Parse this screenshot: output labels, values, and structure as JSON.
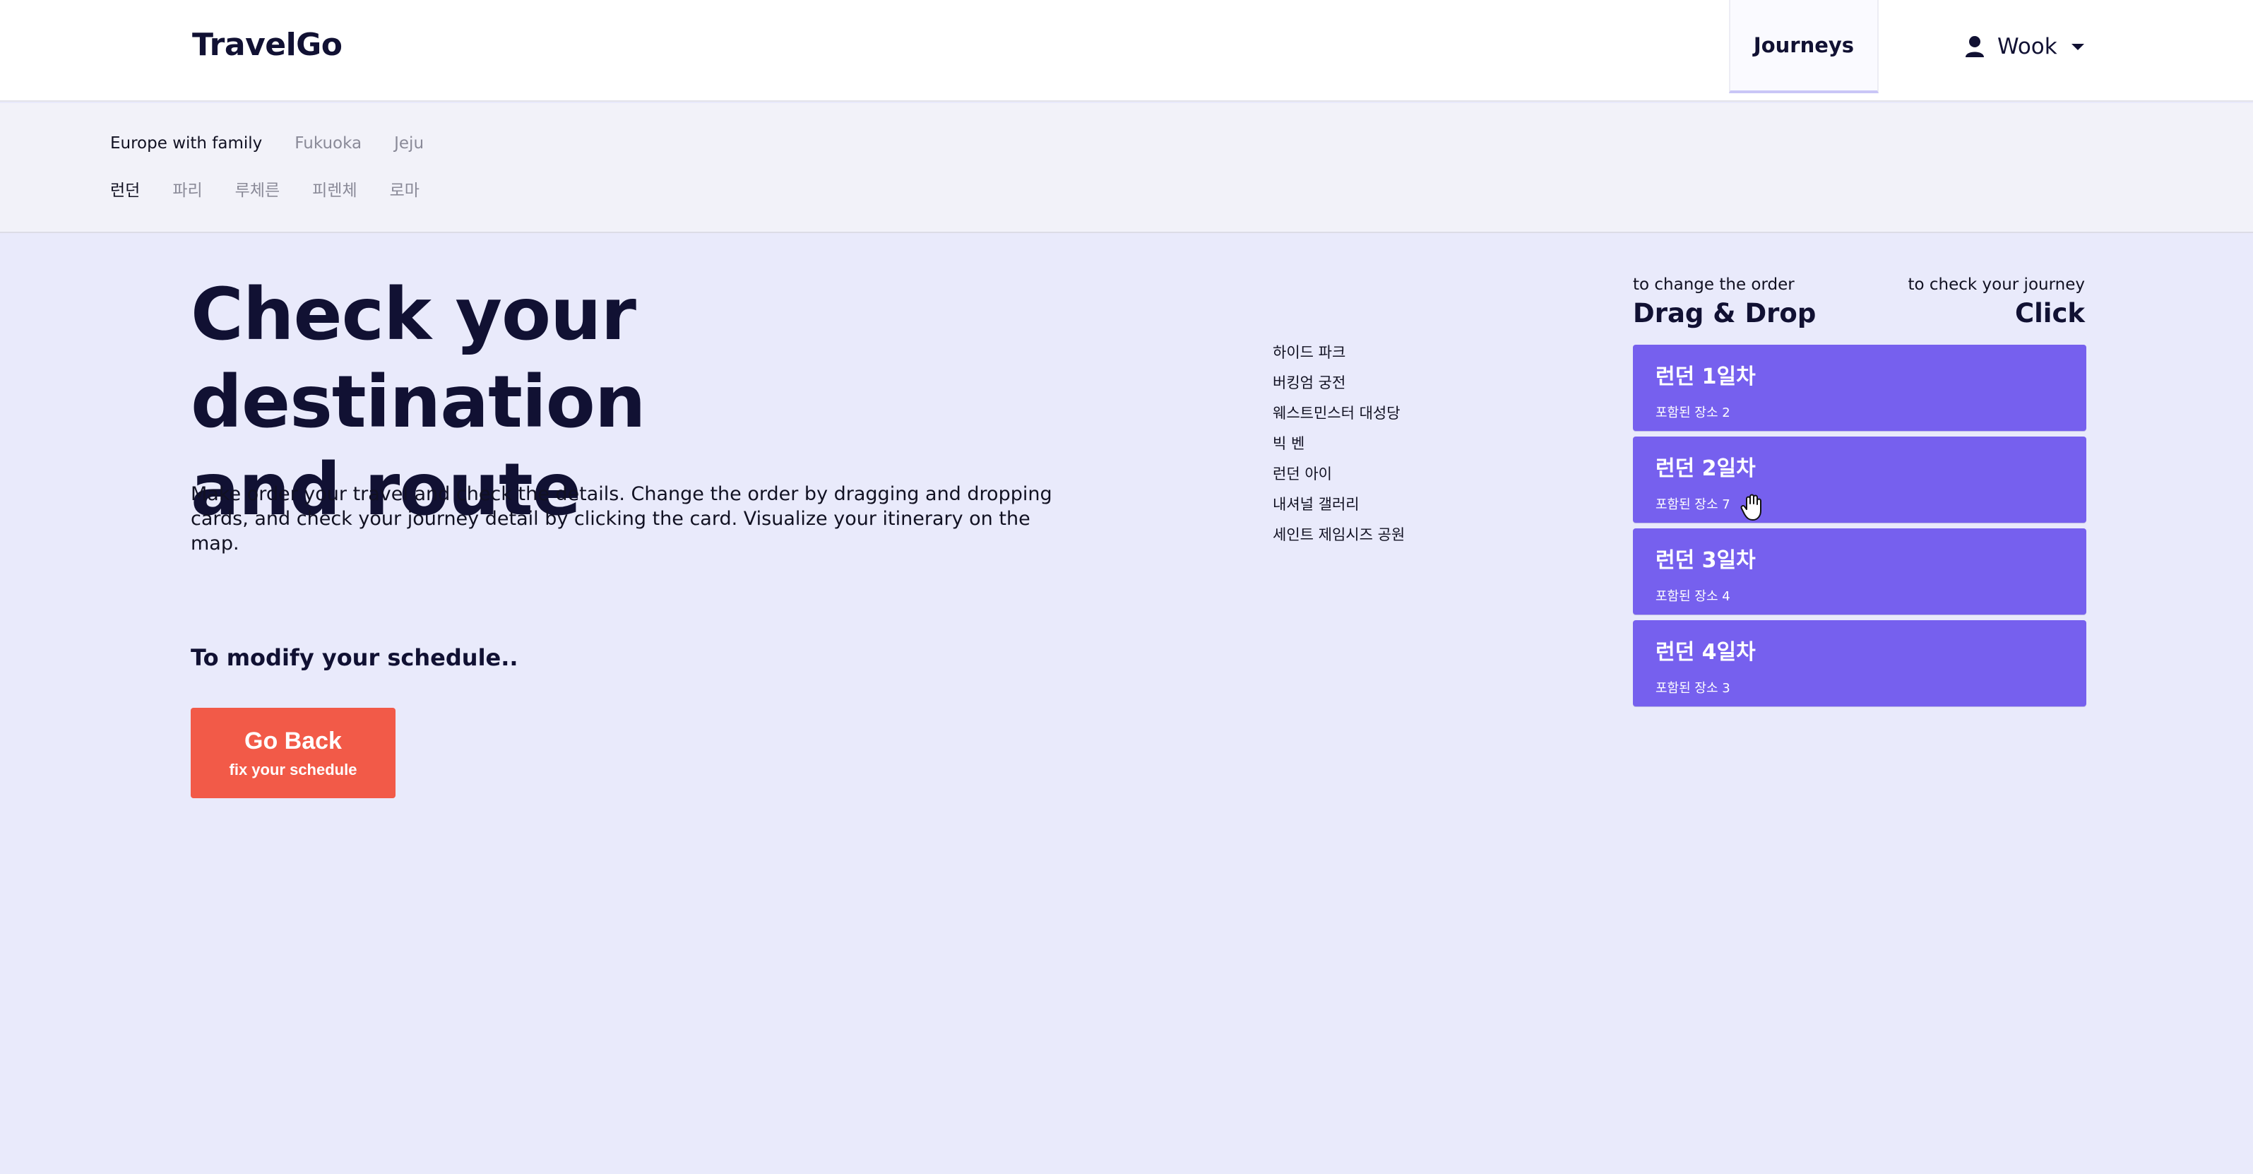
{
  "header": {
    "logo": "TravelGo",
    "nav_journeys": "Journeys",
    "user_name": "Wook",
    "user_icon": "user-icon",
    "dropdown_icon": "caret-down-icon"
  },
  "subnav": {
    "trips": [
      {
        "label": "Europe with family",
        "active": true
      },
      {
        "label": "Fukuoka",
        "active": false
      },
      {
        "label": "Jeju",
        "active": false
      }
    ],
    "cities": [
      {
        "label": "런던",
        "active": true
      },
      {
        "label": "파리",
        "active": false
      },
      {
        "label": "루체른",
        "active": false
      },
      {
        "label": "피렌체",
        "active": false
      },
      {
        "label": "로마",
        "active": false
      }
    ]
  },
  "main": {
    "title_line1": "Check your destination",
    "title_line2": "and route",
    "description": "Make order your travel and check the details. Change the order by dragging and dropping cards, and check your journey detail by clicking the card. Visualize your itinerary on the map.",
    "modify_label": "To modify your schedule..",
    "go_back": {
      "label": "Go Back",
      "sublabel": "fix your schedule"
    }
  },
  "places": [
    "하이드 파크",
    "버킹엄 궁전",
    "웨스트민스터 대성당",
    "빅 벤",
    "런던 아이",
    "내셔널 갤러리",
    "세인트 제임시즈 공원"
  ],
  "panel": {
    "hint_left_small": "to change the order",
    "hint_left_big": "Drag & Drop",
    "hint_right_small": "to check your journey",
    "hint_right_big": "Click",
    "days": [
      {
        "title": "런던 1일차",
        "count": "포함된 장소 2"
      },
      {
        "title": "런던 2일차",
        "count": "포함된 장소 7"
      },
      {
        "title": "런던 3일차",
        "count": "포함된 장소 4"
      },
      {
        "title": "런던 4일차",
        "count": "포함된 장소 3"
      }
    ]
  },
  "colors": {
    "background": "#e9eafb",
    "card": "#7660ee",
    "go_back": "#f25a48",
    "text_dark": "#111133"
  }
}
